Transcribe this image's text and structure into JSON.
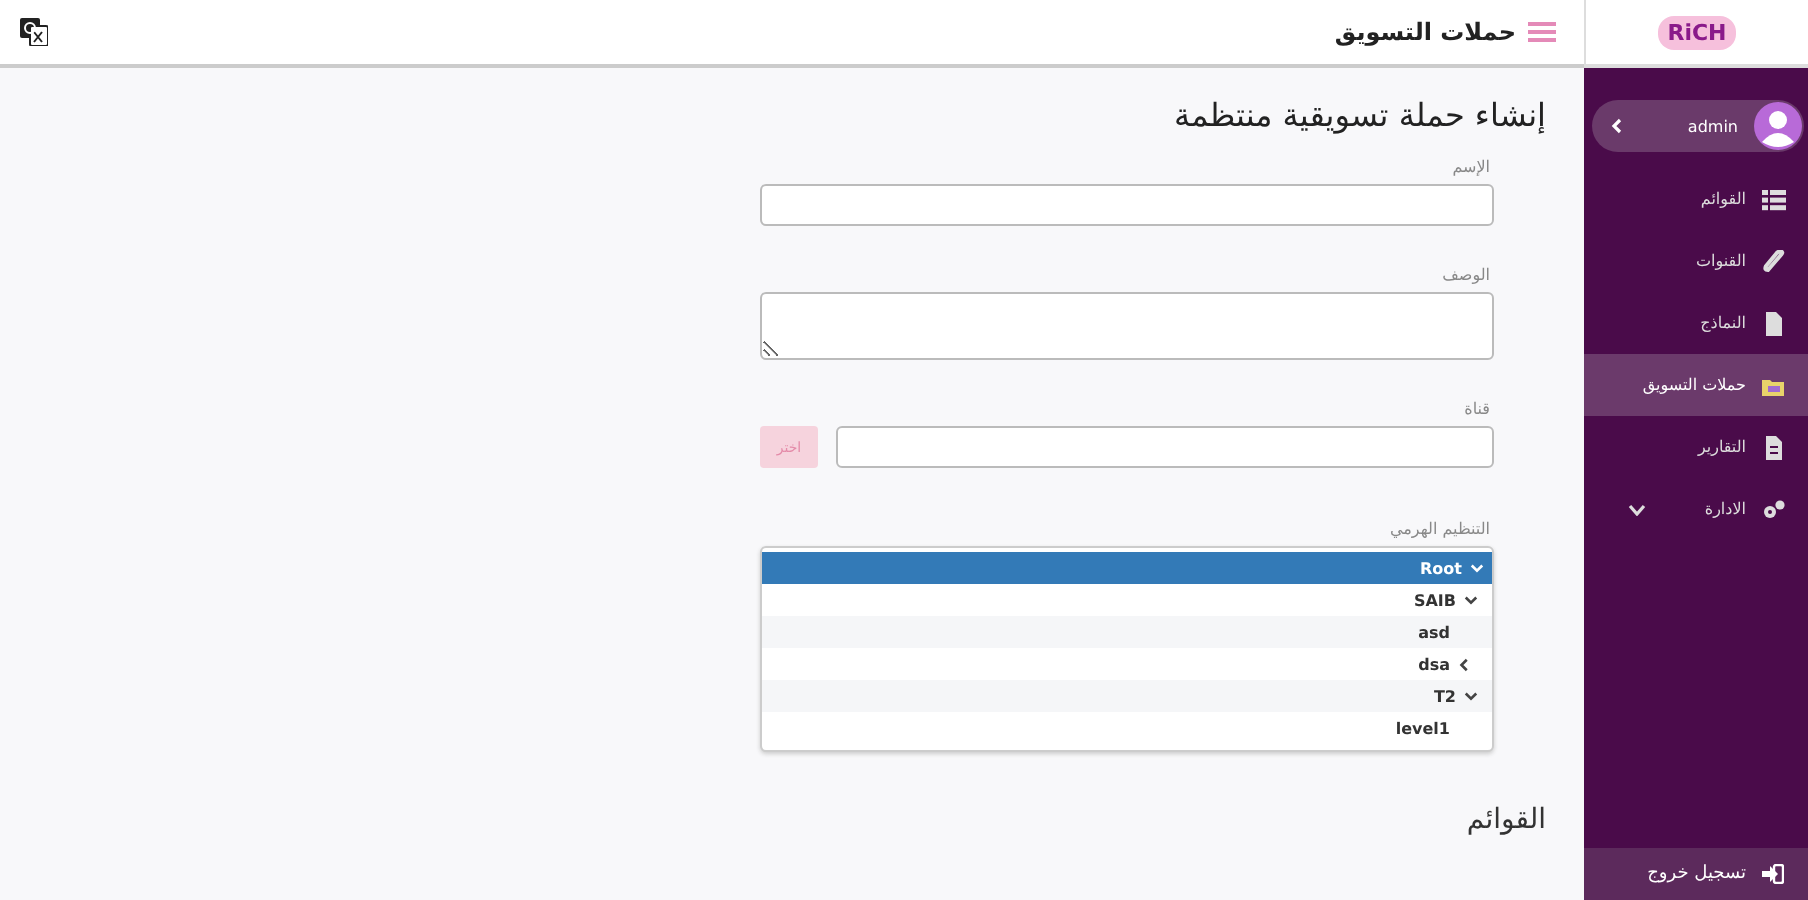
{
  "header": {
    "logo": "RiCH",
    "title": "حملات التسويق"
  },
  "user": {
    "name": "admin"
  },
  "sidebar": {
    "items": [
      {
        "label": "القوائم",
        "selected": false
      },
      {
        "label": "القنوات",
        "selected": false
      },
      {
        "label": "النماذج",
        "selected": false
      },
      {
        "label": "حملات التسويق",
        "selected": true
      },
      {
        "label": "التقارير",
        "selected": false
      },
      {
        "label": "الادارة",
        "selected": false,
        "expanded": false
      }
    ],
    "logout": "تسجيل خروج"
  },
  "form": {
    "heading": "إنشاء حملة تسويقية منتظمة",
    "name_label": "الإسم",
    "description_label": "الوصف",
    "channel_label": "قناة",
    "channel_button": "اختر",
    "hierarchy_label": "التنظيم الهرمي",
    "tree": [
      {
        "label": "Root",
        "selected": true,
        "expanded": true,
        "children": [
          {
            "label": "SAIB",
            "selected": false,
            "expanded": true,
            "children": [
              {
                "label": "asd",
                "selected": false
              },
              {
                "label": "dsa",
                "selected": false,
                "expanded": false
              }
            ]
          },
          {
            "label": "T2",
            "selected": false,
            "expanded": true,
            "children": [
              {
                "label": "level1",
                "selected": false
              }
            ]
          }
        ]
      }
    ]
  },
  "lists_heading": "القوائم"
}
